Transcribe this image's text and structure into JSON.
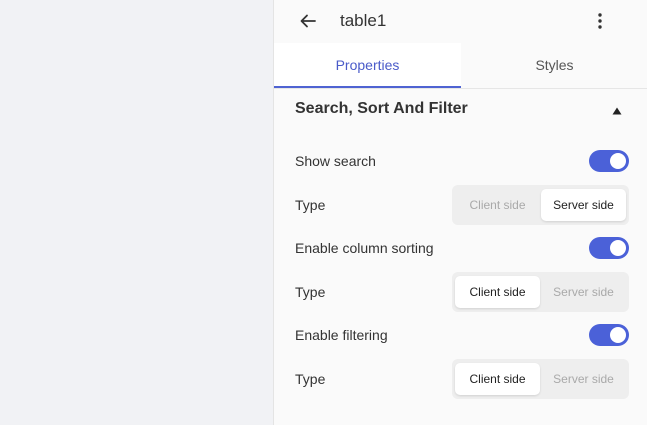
{
  "header": {
    "title": "table1",
    "back_icon": "arrow-left-icon",
    "more_icon": "more-vertical-icon"
  },
  "tabs": [
    {
      "label": "Properties",
      "active": true
    },
    {
      "label": "Styles",
      "active": false
    }
  ],
  "section": {
    "title": "Search, Sort And Filter",
    "collapse_icon": "triangle-up-icon",
    "expanded": true
  },
  "settings": [
    {
      "label": "Show search",
      "enabled": true,
      "type_label": "Type",
      "options": [
        "Client side",
        "Server side"
      ],
      "selected": "Server side"
    },
    {
      "label": "Enable column sorting",
      "enabled": true,
      "type_label": "Type",
      "options": [
        "Client side",
        "Server side"
      ],
      "selected": "Client side"
    },
    {
      "label": "Enable filtering",
      "enabled": true,
      "type_label": "Type",
      "options": [
        "Client side",
        "Server side"
      ],
      "selected": "Client side"
    }
  ],
  "colors": {
    "accent": "#4b61d8",
    "canvas_bg": "#f1f2f5",
    "panel_bg": "#fafafa"
  }
}
